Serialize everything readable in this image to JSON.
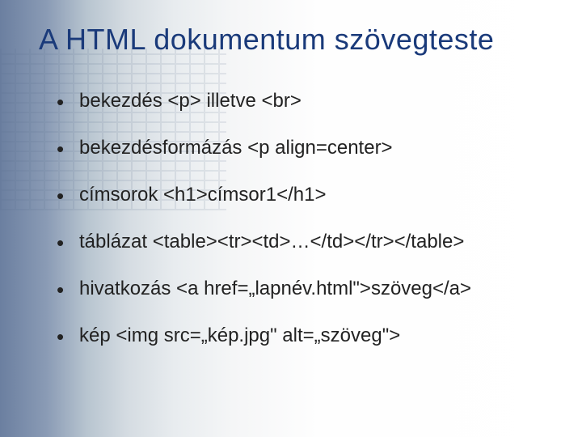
{
  "slide": {
    "title": "A HTML dokumentum szövegteste",
    "bullets": [
      "bekezdés <p> illetve <br>",
      "bekezdésformázás <p align=center>",
      "címsorok <h1>címsor1</h1>",
      "táblázat  <table><tr><td>…</td></tr></table>",
      "hivatkozás <a href=„lapnév.html\">szöveg</a>",
      "kép  <img src=„kép.jpg\" alt=„szöveg\">"
    ]
  }
}
